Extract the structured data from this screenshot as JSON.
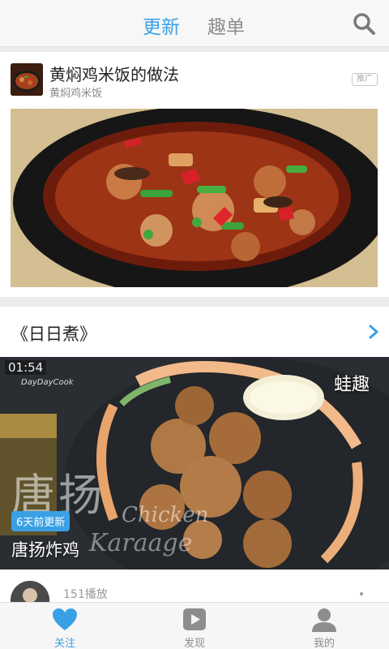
{
  "header": {
    "tabs": [
      {
        "label": "更新",
        "active": true
      },
      {
        "label": "趣单",
        "active": false
      }
    ],
    "search_icon": "search-icon"
  },
  "promo": {
    "title": "黄焖鸡米饭的做法",
    "subtitle": "黄焖鸡米饭",
    "badge": "推广"
  },
  "section": {
    "title": "《日日煮》",
    "video": {
      "duration": "01:54",
      "brand": "DayDayCook",
      "update_badge": "6天前更新",
      "title": "唐扬炸鸡",
      "overlay_cn": "唐扬",
      "overlay_en_1": "Chicken",
      "overlay_en_2": "Karaage",
      "corner_tag": "蛙趣"
    },
    "meta": {
      "plays": "151播放"
    }
  },
  "bottom_nav": [
    {
      "label": "关注",
      "icon": "heart-icon",
      "active": true
    },
    {
      "label": "发现",
      "icon": "play-icon",
      "active": false
    },
    {
      "label": "我的",
      "icon": "user-icon",
      "active": false
    }
  ],
  "colors": {
    "accent": "#3aa0e6",
    "inactive": "#8d8d8d",
    "background": "#ececec"
  }
}
